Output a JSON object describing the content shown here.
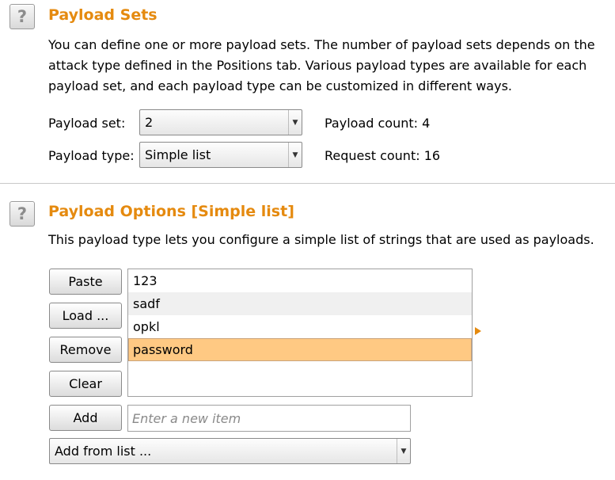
{
  "payload_sets": {
    "help_icon": "?",
    "title": "Payload Sets",
    "description": "You can define one or more payload sets. The number of payload sets depends on the attack type defined in the Positions tab. Various payload types are available for each payload set, and each payload type can be customized in different ways.",
    "payload_set_label": "Payload set:",
    "payload_set_value": "2",
    "payload_type_label": "Payload type:",
    "payload_type_value": "Simple list",
    "payload_count_label": "Payload count:",
    "payload_count_value": "4",
    "request_count_label": "Request count:",
    "request_count_value": "16"
  },
  "payload_options": {
    "help_icon": "?",
    "title": "Payload Options [Simple list]",
    "description": "This payload type lets you configure a simple list of strings that are used as payloads.",
    "buttons": {
      "paste": "Paste",
      "load": "Load ...",
      "remove": "Remove",
      "clear": "Clear",
      "add": "Add"
    },
    "items": [
      "123",
      "sadf",
      "opkl",
      "password"
    ],
    "selected_index": 3,
    "new_item_placeholder": "Enter a new item",
    "add_from_list": "Add from list ..."
  },
  "icons": {
    "dropdown": "dropdown-arrow-icon",
    "expand": "expand-triangle-icon"
  },
  "colors": {
    "title": "#e58a0f",
    "selection": "#ffc983",
    "alt_row": "#f0f0f0"
  }
}
